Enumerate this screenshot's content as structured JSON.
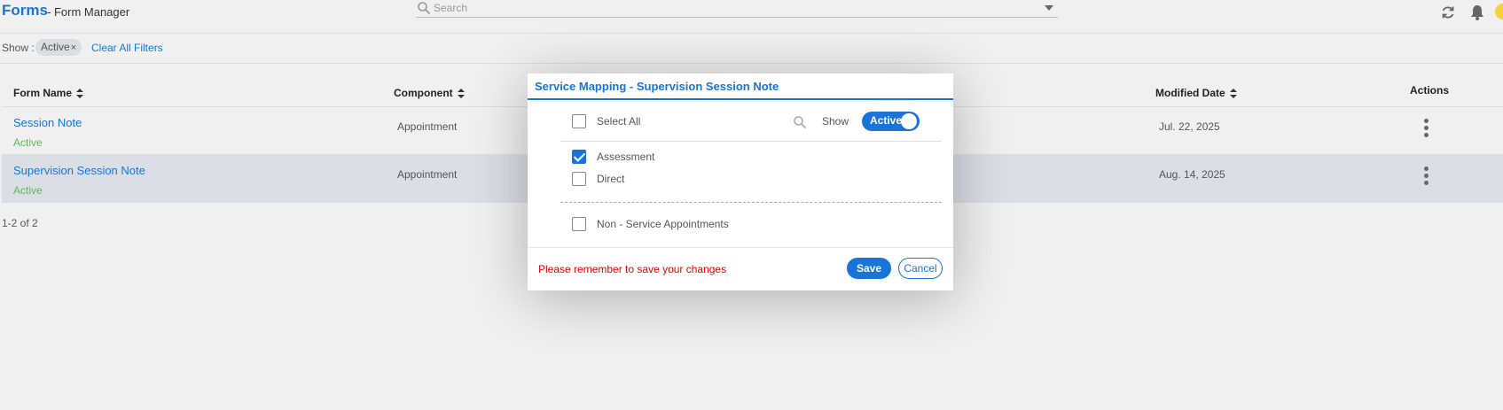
{
  "header": {
    "brand": "Forms",
    "subtitle": "- Form Manager",
    "search_placeholder": "Search",
    "icons": [
      "refresh-icon",
      "bell-icon",
      "avatar"
    ]
  },
  "filters": {
    "label": "Show :",
    "chips": [
      {
        "label": "Active",
        "remove": "×"
      }
    ],
    "clear_label": "Clear All Filters"
  },
  "table": {
    "columns": {
      "form_name": "Form Name",
      "component": "Component",
      "modified_date": "Modified Date",
      "actions": "Actions"
    },
    "rows": [
      {
        "name": "Session Note",
        "status": "Active",
        "component": "Appointment",
        "modified": "Jul. 22, 2025",
        "selected": false
      },
      {
        "name": "Supervision Session Note",
        "status": "Active",
        "component": "Appointment",
        "modified": "Aug. 14, 2025",
        "selected": true
      }
    ],
    "count_label": "1-2 of 2"
  },
  "modal": {
    "title": "Service Mapping - Supervision Session Note",
    "select_all_label": "Select All",
    "show_label": "Show",
    "toggle_label": "Active",
    "toggle_on": true,
    "items": [
      {
        "label": "Assessment",
        "checked": true
      },
      {
        "label": "Direct",
        "checked": false
      }
    ],
    "non_service_label": "Non - Service Appointments",
    "warning": "Please remember to save your changes",
    "save_label": "Save",
    "cancel_label": "Cancel"
  },
  "colors": {
    "accent": "#1a73d9",
    "active_status": "#5cb85c",
    "warning": "#ee0000",
    "background": "#f0f0f0",
    "selected_row": "#dcdee5"
  }
}
